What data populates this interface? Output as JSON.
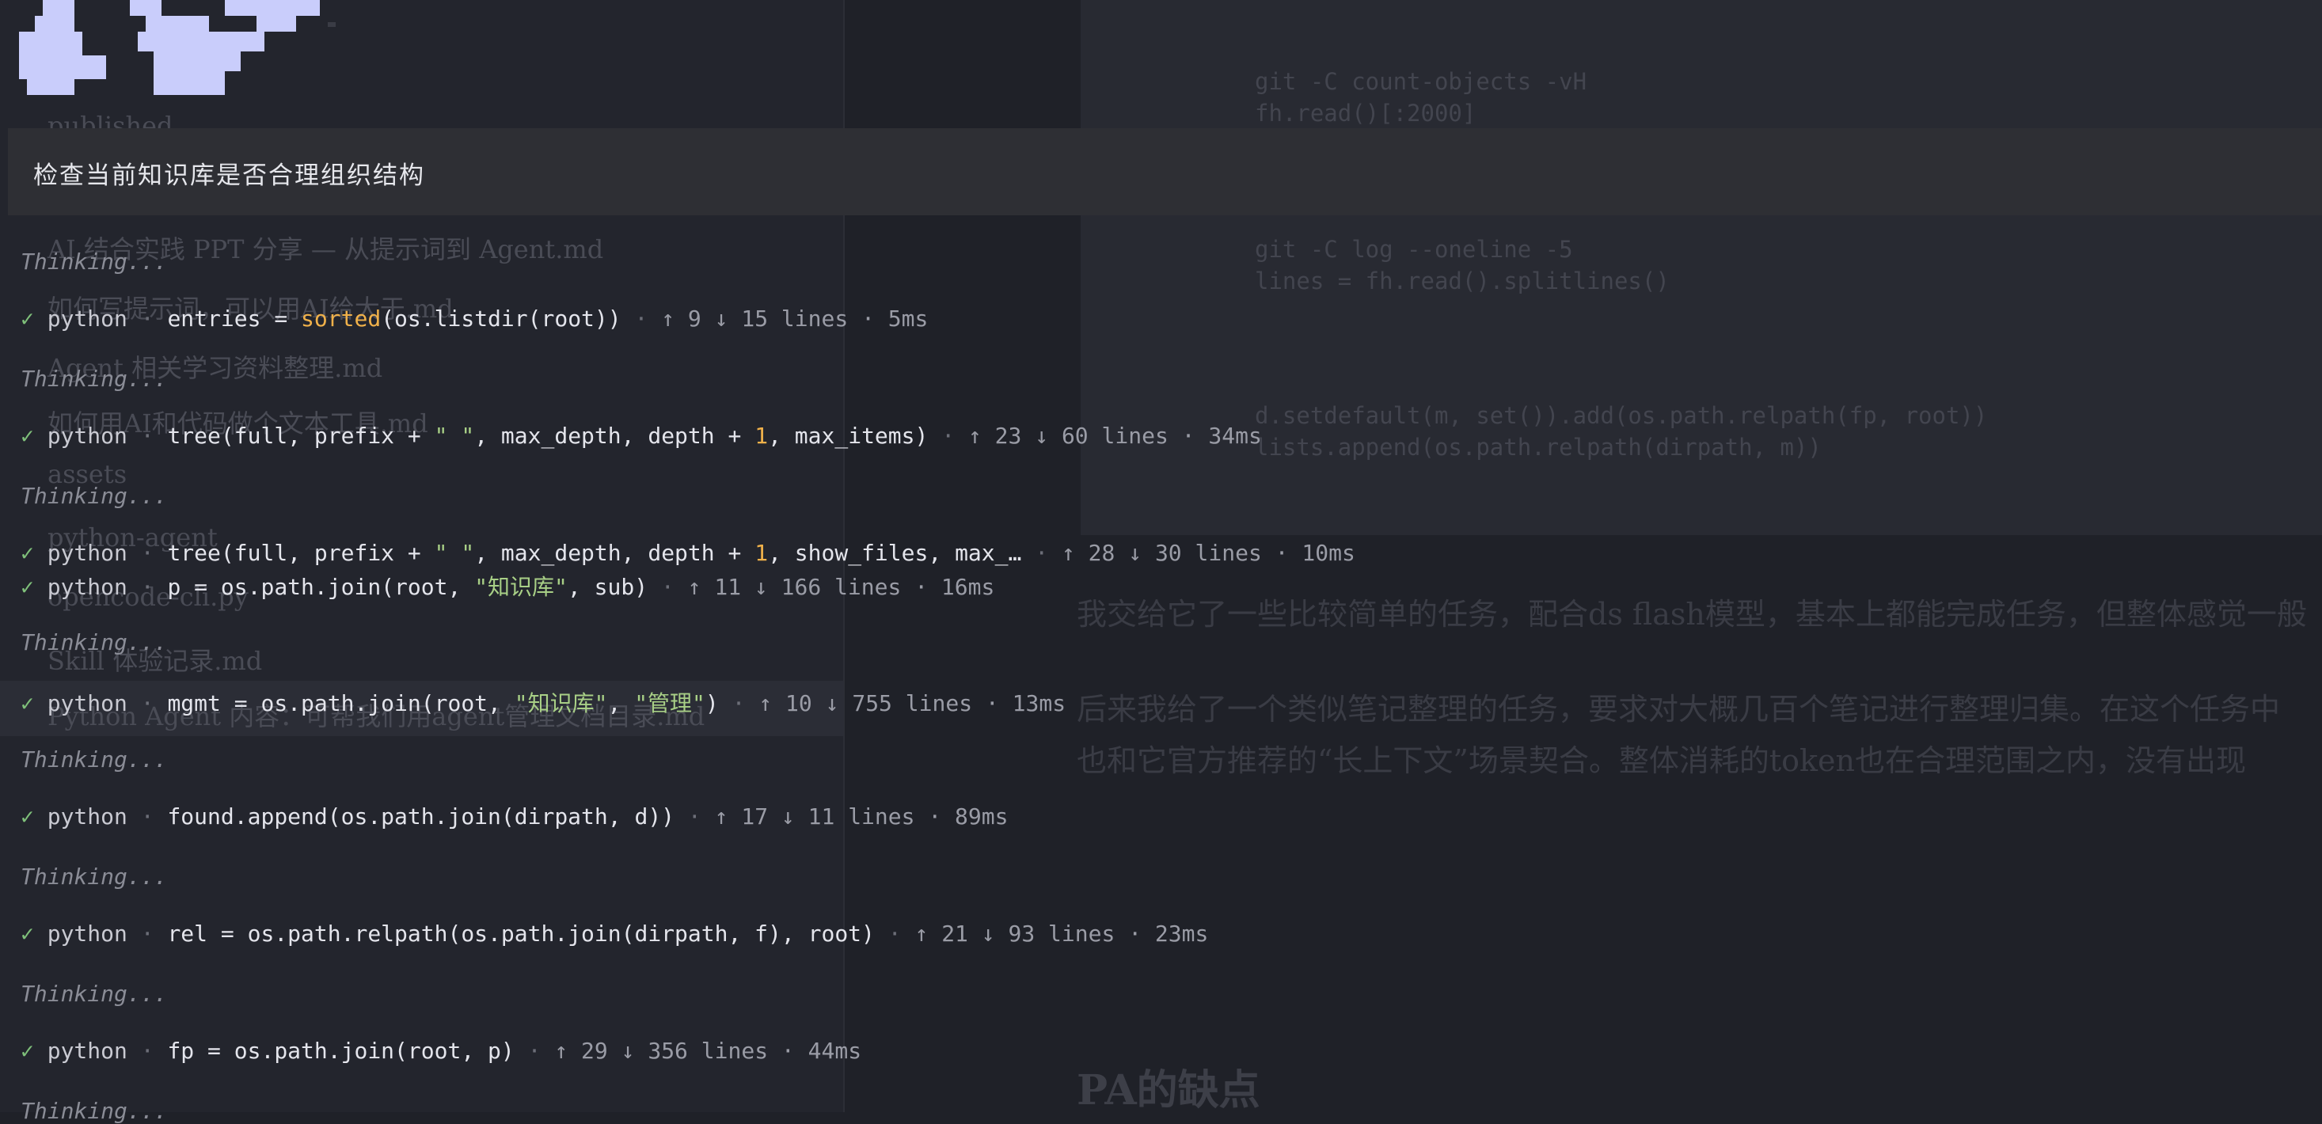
{
  "prompt": "检查当前知识库是否合理组织结构",
  "thinking_label": "Thinking...",
  "check_mark": "✓",
  "separator": "·",
  "tool_calls": [
    {
      "tool": "python",
      "code": [
        {
          "t": "entries = ",
          "c": "code"
        },
        {
          "t": "sorted",
          "c": "kw"
        },
        {
          "t": "(os.listdir(root))",
          "c": "code"
        }
      ],
      "stats": "↑ 9 ↓ 15 lines · 5ms"
    },
    {
      "tool": "python",
      "code": [
        {
          "t": "tree(full, prefix + ",
          "c": "code"
        },
        {
          "t": "\"  \"",
          "c": "str"
        },
        {
          "t": ", max_depth, depth + ",
          "c": "code"
        },
        {
          "t": "1",
          "c": "num"
        },
        {
          "t": ", max_items)",
          "c": "code"
        }
      ],
      "stats": "↑ 23 ↓ 60 lines · 34ms"
    },
    {
      "tool": "python",
      "code": [
        {
          "t": "tree(full, prefix + ",
          "c": "code"
        },
        {
          "t": "\"  \"",
          "c": "str"
        },
        {
          "t": ", max_depth, depth + ",
          "c": "code"
        },
        {
          "t": "1",
          "c": "num"
        },
        {
          "t": ", show_files, max_…",
          "c": "code"
        }
      ],
      "stats": "↑ 28 ↓ 30 lines · 10ms"
    },
    {
      "tool": "python",
      "code": [
        {
          "t": "p = os.path.join(root, ",
          "c": "code"
        },
        {
          "t": "\"知识库\"",
          "c": "str"
        },
        {
          "t": ", sub)",
          "c": "code"
        }
      ],
      "stats": "↑ 11 ↓ 166 lines · 16ms"
    },
    {
      "tool": "python",
      "code": [
        {
          "t": "mgmt = os.path.join(root, ",
          "c": "code"
        },
        {
          "t": "\"知识库\"",
          "c": "str"
        },
        {
          "t": ", ",
          "c": "code"
        },
        {
          "t": "\"管理\"",
          "c": "str"
        },
        {
          "t": ")",
          "c": "code"
        }
      ],
      "stats": "↑ 10 ↓ 755 lines · 13ms"
    },
    {
      "tool": "python",
      "code": [
        {
          "t": "found.append(os.path.join(dirpath, d))",
          "c": "code"
        }
      ],
      "stats": "↑ 17 ↓ 11 lines · 89ms"
    },
    {
      "tool": "python",
      "code": [
        {
          "t": "rel = os.path.relpath(os.path.join(dirpath, f), root)",
          "c": "code"
        }
      ],
      "stats": "↑ 21 ↓ 93 lines · 23ms"
    },
    {
      "tool": "python",
      "code": [
        {
          "t": "fp = os.path.join(root, p)",
          "c": "code"
        }
      ],
      "stats": "↑ 29 ↓ 356 lines · 44ms"
    }
  ],
  "background": {
    "tree_items": [
      "published",
      "AI 结合实践 PPT 分享 — 从提示词到 Agent.md",
      "如何写提示词，可以用AI给大于.md",
      "Agent 相关学习资料整理.md",
      "如何用AI和代码做个文本工具.md",
      "assets",
      "python-agent",
      "opencode-cli.py",
      "Skill 体验记录.md",
      "Python Agent 内容：可帮我们用agent管理文档目录.md"
    ],
    "code_lines": [
      "git -C count-objects -vH",
      "fh.read()[:2000]",
      "git -C log --oneline -5",
      "lines = fh.read().splitlines()",
      "d.setdefault(m, set()).add(os.path.relpath(fp, root))",
      "lists.append(os.path.relpath(dirpath, m))"
    ],
    "prose": [
      "我交给它了一些比较简单的任务，配合ds flash模型，基本上都能完成任务，但整体感觉一般",
      "后来我给了一个类似笔记整理的任务，要求对大概几百个笔记进行整理归集。在这个任务中",
      "也和它官方推荐的“长上下文”场景契合。整体消耗的token也在合理范围之内，没有出现"
    ],
    "heading": "PA的缺点"
  }
}
